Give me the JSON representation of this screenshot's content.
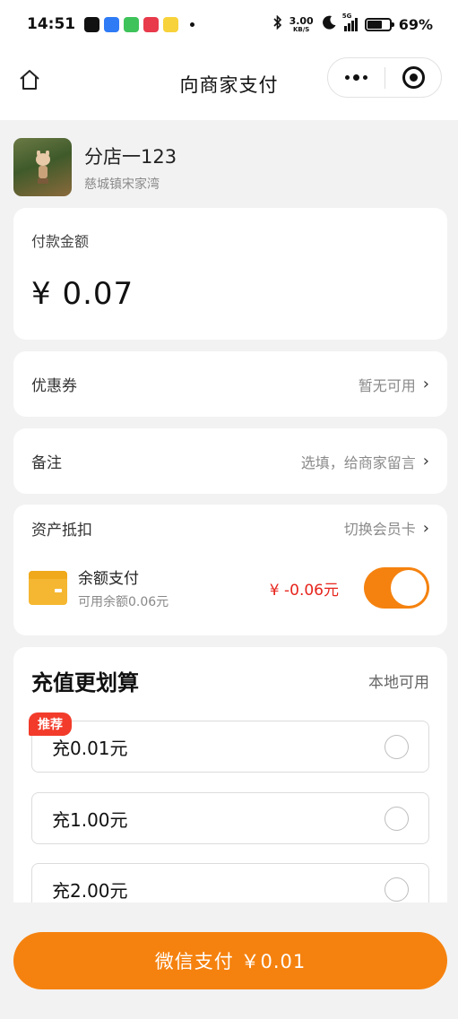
{
  "status_bar": {
    "time": "14:51",
    "net_speed_value": "3.00",
    "net_speed_unit": "KB/S",
    "network": "5G",
    "battery": "69%",
    "battery_level": 0.69
  },
  "nav": {
    "title": "向商家支付"
  },
  "merchant": {
    "name": "分店一123",
    "address": "慈城镇宋家湾"
  },
  "amount": {
    "label": "付款金额",
    "value": "¥ 0.07"
  },
  "coupon": {
    "label": "优惠券",
    "value": "暂无可用",
    "chevron": "›"
  },
  "remark": {
    "label": "备注",
    "value": "选填，给商家留言",
    "chevron": "›"
  },
  "assets": {
    "label": "资产抵扣",
    "switch_card": "切换会员卡",
    "chevron": "›",
    "balance_title": "余额支付",
    "balance_sub": "可用余额0.06元",
    "deduction": "¥ -0.06元",
    "toggle_on": true
  },
  "recharge": {
    "title": "充值更划算",
    "scope": "本地可用",
    "badge": "推荐",
    "options": [
      {
        "label": "充0.01元"
      },
      {
        "label": "充1.00元"
      },
      {
        "label": "充2.00元"
      }
    ]
  },
  "pay_button": {
    "label": "微信支付 ￥0.01"
  },
  "colors": {
    "accent": "#f5820f",
    "deduction": "#e6241c",
    "badge": "#f23b2a",
    "wallet": "#f5b731"
  }
}
